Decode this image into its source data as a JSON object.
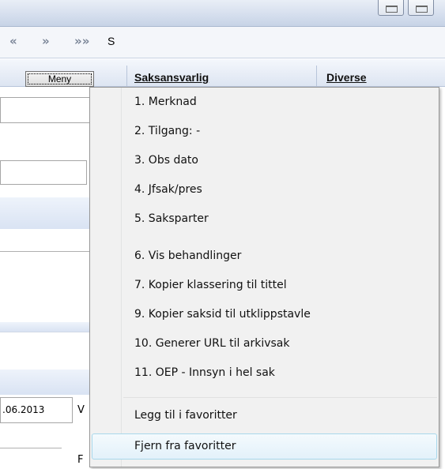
{
  "toolbar": {
    "nav_buttons": [
      {
        "label": "«",
        "name": "first"
      },
      {
        "label": "»",
        "name": "next"
      },
      {
        "label": "»»",
        "name": "last"
      }
    ],
    "trailing_text": "S"
  },
  "header": {
    "menu_button_label": "Meny",
    "columns": [
      "Saksansvarlig",
      "Diverse"
    ]
  },
  "form": {
    "date_value": ".06.2013",
    "label_v": "V",
    "label_f": "F"
  },
  "context_menu": {
    "items": [
      "1. Merknad",
      "2. Tilgang: -",
      "3. Obs dato",
      "4. Jfsak/pres",
      "5. Saksparter",
      "6. Vis behandlinger",
      "7. Kopier klassering til tittel",
      "9. Kopier saksid til utklippstavle",
      "10. Generer URL til arkivsak",
      "11. OEP - Innsyn i hel sak"
    ],
    "favorites": [
      "Legg til i favoritter",
      "Fjern fra favoritter"
    ],
    "hovered_item": "Fjern fra favoritter"
  }
}
